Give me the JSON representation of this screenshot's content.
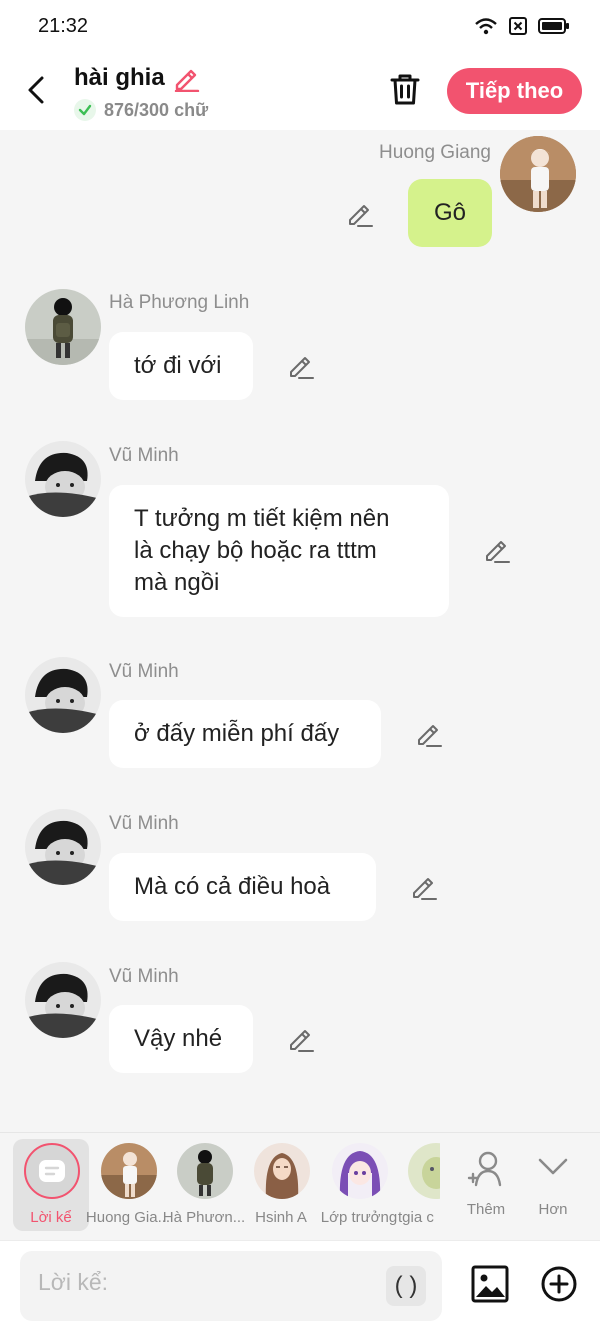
{
  "status_bar": {
    "time": "21:32"
  },
  "header": {
    "title": "hài ghia",
    "word_count": "876/300 chữ",
    "next_button": "Tiếp theo"
  },
  "messages": [
    {
      "sender": "Huong Giang",
      "text": "Gô",
      "side": "right"
    },
    {
      "sender": "Hà Phương Linh",
      "text": "tớ đi với",
      "side": "left"
    },
    {
      "sender": "Vũ Minh",
      "lines": [
        "T tưởng m tiết kiệm nên",
        "là chạy bộ hoặc ra tttm",
        "mà ngồi"
      ],
      "side": "left"
    },
    {
      "sender": "Vũ Minh",
      "text": "ở đấy miễn phí đấy",
      "side": "left"
    },
    {
      "sender": "Vũ Minh",
      "text": "Mà có cả điều hoà",
      "side": "left"
    },
    {
      "sender": "Vũ Minh",
      "text": "Vậy nhé",
      "side": "left"
    }
  ],
  "character_tray": {
    "items": [
      "Lời kể",
      "Huong Gia...",
      "Hà Phươn...",
      "Hsinh A",
      "Lớp trưởng",
      "tgia c"
    ],
    "more_label": "Thêm",
    "expand_label": "Hơn"
  },
  "composer": {
    "placeholder": "Lời kể:",
    "paren_label": "( )"
  },
  "colors": {
    "accent": "#f2536f",
    "my_bubble": "#d5f28c",
    "background": "#f5f5f5"
  }
}
